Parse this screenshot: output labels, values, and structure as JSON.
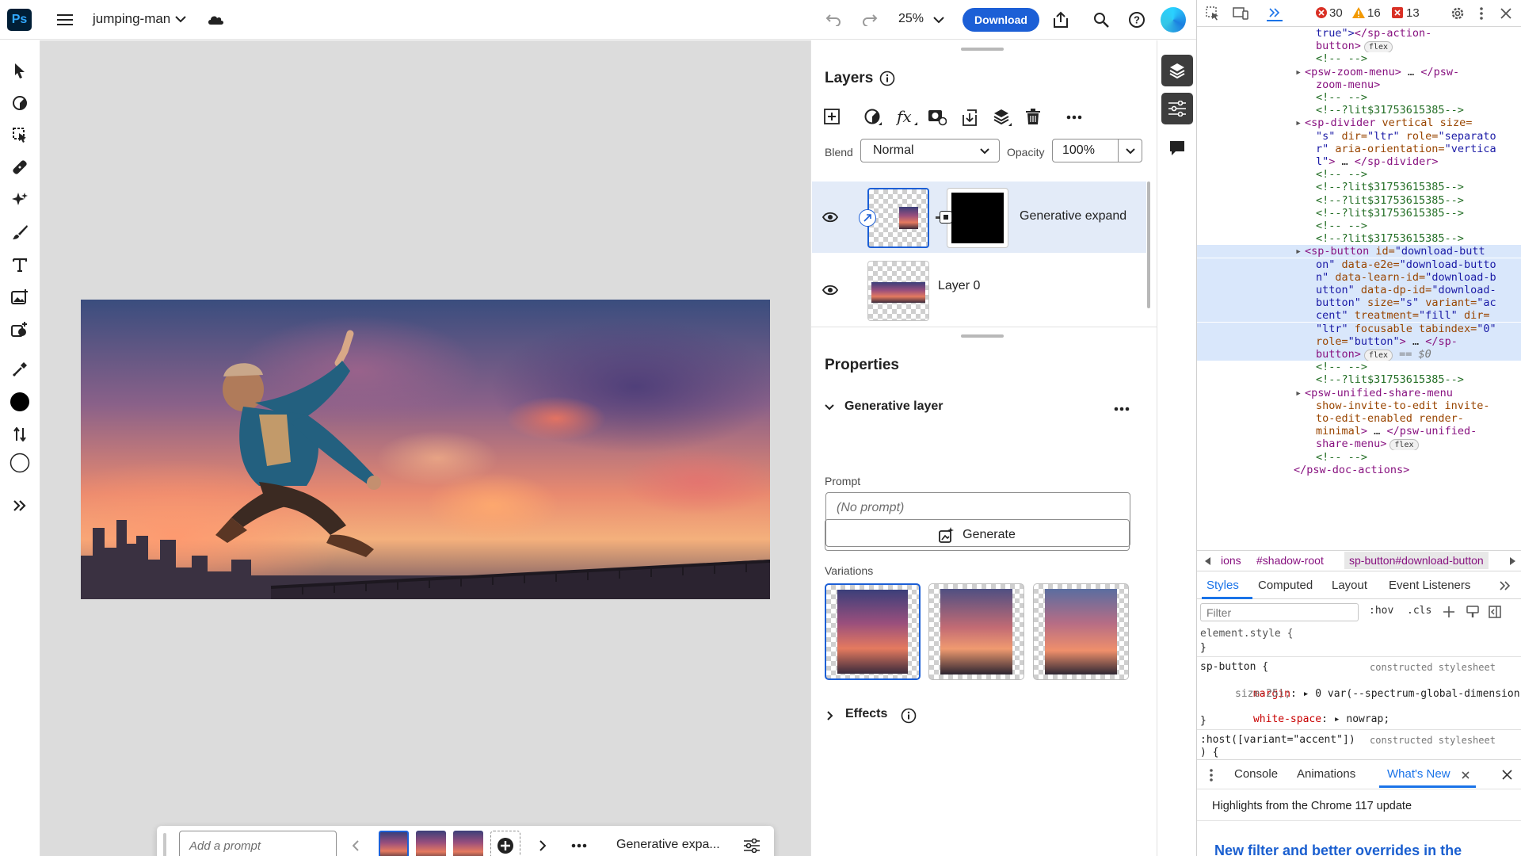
{
  "app": {
    "logo_text": "Ps",
    "document_name": "jumping-man",
    "zoom": "25%",
    "download_label": "Download",
    "accent_color": "#1c5fd6"
  },
  "taskbar": {
    "prompt_placeholder": "Add a prompt",
    "label": "Generative expa..."
  },
  "layers_panel": {
    "title": "Layers",
    "blend_label": "Blend",
    "blend_value": "Normal",
    "opacity_label": "Opacity",
    "opacity_value": "100%",
    "layers": [
      {
        "name": "Generative expand",
        "visible": true,
        "selected": true
      },
      {
        "name": "Layer 0",
        "visible": true,
        "selected": false
      }
    ]
  },
  "properties_panel": {
    "title": "Properties",
    "section_title": "Generative layer",
    "prompt_label": "Prompt",
    "prompt_placeholder": "(No prompt)",
    "generate_label": "Generate",
    "variations_label": "Variations",
    "effects_label": "Effects"
  },
  "devtools": {
    "counts": {
      "errors": "30",
      "warnings": "16",
      "issues": "13"
    },
    "code_lines": [
      {
        "indent": 20,
        "parts": [
          [
            "val",
            "true\">"
          ],
          [
            "tag",
            "</sp-action-"
          ]
        ]
      },
      {
        "indent": 20,
        "parts": [
          [
            "tag",
            "button>"
          ]
        ],
        "pill": "flex"
      },
      {
        "indent": 20,
        "parts": [
          [
            "cmt",
            "<!-- -->"
          ]
        ]
      },
      {
        "indent": 18,
        "arrow": true,
        "parts": [
          [
            "tag",
            "<psw-zoom-menu>"
          ],
          [
            "plain",
            " … "
          ],
          [
            "tag",
            "</psw-"
          ]
        ]
      },
      {
        "indent": 20,
        "parts": [
          [
            "tag",
            "zoom-menu>"
          ]
        ]
      },
      {
        "indent": 20,
        "parts": [
          [
            "cmt",
            "<!-- -->"
          ]
        ]
      },
      {
        "indent": 20,
        "parts": [
          [
            "cmt",
            "<!--?lit$31753615385-->"
          ]
        ]
      },
      {
        "indent": 18,
        "arrow": true,
        "parts": [
          [
            "tag",
            "<sp-divider"
          ],
          [
            "attr",
            " vertical size="
          ]
        ]
      },
      {
        "indent": 20,
        "parts": [
          [
            "val",
            "\"s\""
          ],
          [
            "attr",
            " dir="
          ],
          [
            "val",
            "\"ltr\""
          ],
          [
            "attr",
            " role="
          ],
          [
            "val",
            "\"separato"
          ]
        ]
      },
      {
        "indent": 20,
        "parts": [
          [
            "val",
            "r\""
          ],
          [
            "attr",
            " aria-orientation="
          ],
          [
            "val",
            "\"vertica"
          ]
        ]
      },
      {
        "indent": 20,
        "parts": [
          [
            "val",
            "l\""
          ],
          [
            "tag",
            ">"
          ],
          [
            "plain",
            " … "
          ],
          [
            "tag",
            "</sp-divider>"
          ]
        ]
      },
      {
        "indent": 20,
        "parts": [
          [
            "cmt",
            "<!-- -->"
          ]
        ]
      },
      {
        "indent": 20,
        "parts": [
          [
            "cmt",
            "<!--?lit$31753615385-->"
          ]
        ]
      },
      {
        "indent": 20,
        "parts": [
          [
            "cmt",
            "<!--?lit$31753615385-->"
          ]
        ]
      },
      {
        "indent": 20,
        "parts": [
          [
            "cmt",
            "<!--?lit$31753615385-->"
          ]
        ]
      },
      {
        "indent": 20,
        "parts": [
          [
            "cmt",
            "<!-- -->"
          ]
        ]
      },
      {
        "indent": 20,
        "parts": [
          [
            "cmt",
            "<!--?lit$31753615385-->"
          ]
        ]
      },
      {
        "indent": 18,
        "arrow": true,
        "hl": true,
        "parts": [
          [
            "tag",
            "<sp-button"
          ],
          [
            "attr",
            " id="
          ],
          [
            "val",
            "\"download-butt"
          ]
        ]
      },
      {
        "indent": 20,
        "hl": true,
        "parts": [
          [
            "val",
            "on\""
          ],
          [
            "attr",
            " data-e2e="
          ],
          [
            "val",
            "\"download-butto"
          ]
        ]
      },
      {
        "indent": 20,
        "hl": true,
        "parts": [
          [
            "val",
            "n\""
          ],
          [
            "attr",
            " data-learn-id="
          ],
          [
            "val",
            "\"download-b"
          ]
        ]
      },
      {
        "indent": 20,
        "hl": true,
        "parts": [
          [
            "val",
            "utton\""
          ],
          [
            "attr",
            " data-dp-id="
          ],
          [
            "val",
            "\"download-"
          ]
        ]
      },
      {
        "indent": 20,
        "hl": true,
        "parts": [
          [
            "val",
            "button\""
          ],
          [
            "attr",
            " size="
          ],
          [
            "val",
            "\"s\""
          ],
          [
            "attr",
            " variant="
          ],
          [
            "val",
            "\"ac"
          ]
        ]
      },
      {
        "indent": 20,
        "hl": true,
        "parts": [
          [
            "val",
            "cent\""
          ],
          [
            "attr",
            " treatment="
          ],
          [
            "val",
            "\"fill\""
          ],
          [
            "attr",
            " dir="
          ]
        ]
      },
      {
        "indent": 20,
        "hl": true,
        "parts": [
          [
            "val",
            "\"ltr\""
          ],
          [
            "attr",
            " focusable tabindex="
          ],
          [
            "val",
            "\"0\""
          ]
        ]
      },
      {
        "indent": 20,
        "hl": true,
        "parts": [
          [
            "attr",
            "role="
          ],
          [
            "val",
            "\"button\""
          ],
          [
            "tag",
            ">"
          ],
          [
            "plain",
            " … "
          ],
          [
            "tag",
            "</sp-"
          ]
        ]
      },
      {
        "indent": 20,
        "hl": true,
        "parts": [
          [
            "tag",
            "button>"
          ]
        ],
        "pill": "flex",
        "suffix": " == $0"
      },
      {
        "indent": 20,
        "parts": [
          [
            "cmt",
            "<!-- -->"
          ]
        ]
      },
      {
        "indent": 20,
        "parts": [
          [
            "cmt",
            "<!--?lit$31753615385-->"
          ]
        ]
      },
      {
        "indent": 18,
        "arrow": true,
        "parts": [
          [
            "tag",
            "<psw-unified-share-menu"
          ]
        ]
      },
      {
        "indent": 20,
        "parts": [
          [
            "attr",
            "show-invite-to-edit invite-"
          ]
        ]
      },
      {
        "indent": 20,
        "parts": [
          [
            "attr",
            "to-edit-enabled render-"
          ]
        ]
      },
      {
        "indent": 20,
        "parts": [
          [
            "attr",
            "minimal"
          ],
          [
            "tag",
            ">"
          ],
          [
            "plain",
            " … "
          ],
          [
            "tag",
            "</psw-unified-"
          ]
        ]
      },
      {
        "indent": 20,
        "parts": [
          [
            "tag",
            "share-menu>"
          ]
        ],
        "pill": "flex"
      },
      {
        "indent": 20,
        "parts": [
          [
            "cmt",
            "<!-- -->"
          ]
        ]
      },
      {
        "indent": 16,
        "parts": [
          [
            "tag",
            "</psw-doc-actions>"
          ]
        ]
      }
    ],
    "breadcrumbs": [
      "ions",
      "#shadow-root",
      "sp-button#download-button"
    ],
    "tabs": [
      "Styles",
      "Computed",
      "Layout",
      "Event Listeners"
    ],
    "filter_placeholder": "Filter",
    "hov": ":hov",
    "cls": ".cls",
    "styles": {
      "element_style": "element.style {",
      "close1": "}",
      "rule2_selector": "sp-button {",
      "rule2_source": "constructed stylesheet",
      "rule2_prop1": "margin",
      "rule2_val1": "0 var(--spectrum-global-dimension-",
      "rule2_val1b": "size-25);",
      "rule2_prop2": "white-space",
      "rule2_val2": "nowrap;",
      "close2": "}",
      "rule3_selector": ":host([variant=\"accent\"])",
      "rule3_source": "constructed stylesheet",
      "rule3_tail": ") {"
    },
    "drawer_tabs": [
      "Console",
      "Animations",
      "What's New"
    ],
    "drawer_heading": "Highlights from the Chrome 117 update",
    "drawer_link": "New filter and better overrides in the"
  }
}
